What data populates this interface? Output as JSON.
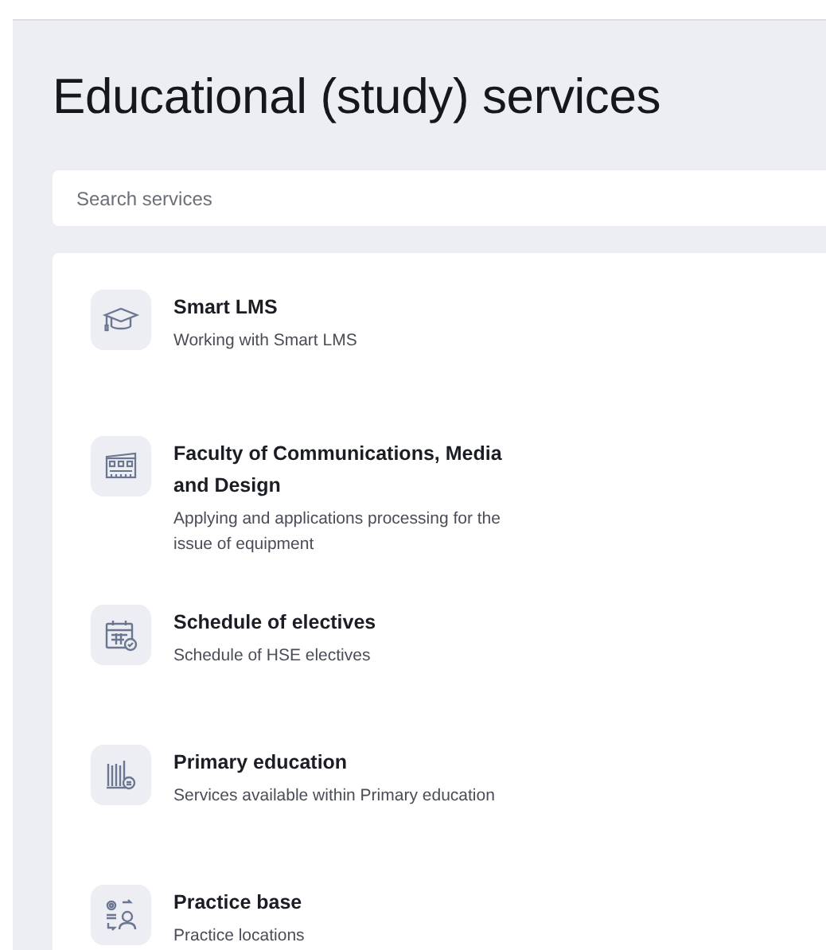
{
  "title": "Educational (study) services",
  "search": {
    "placeholder": "Search services"
  },
  "services": [
    {
      "name": "Smart LMS",
      "description": "Working with Smart LMS"
    },
    {
      "name": "Faculty of Communications, Media and Design",
      "description": "Applying and applications processing for the issue of equipment"
    },
    {
      "name": "Schedule of electives",
      "description": "Schedule of HSE electives"
    },
    {
      "name": "Primary education",
      "description": "Services available within Primary education"
    },
    {
      "name": "Practice base",
      "description": "Practice locations"
    }
  ]
}
